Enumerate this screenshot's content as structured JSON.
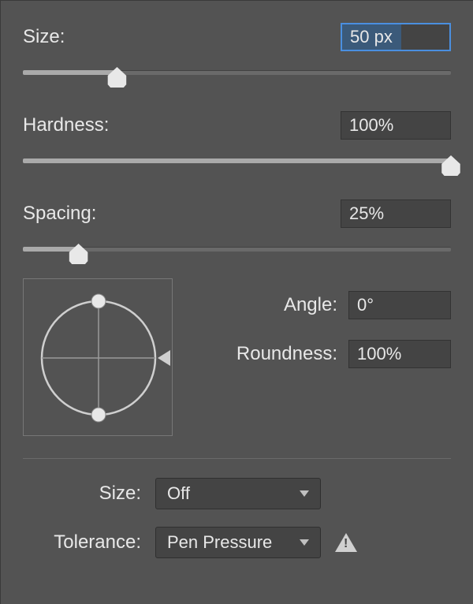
{
  "size": {
    "label": "Size:",
    "value": "50 px",
    "percent": 22
  },
  "hardness": {
    "label": "Hardness:",
    "value": "100%",
    "percent": 100
  },
  "spacing": {
    "label": "Spacing:",
    "value": "25%",
    "percent": 13
  },
  "angle": {
    "label": "Angle:",
    "value": "0°"
  },
  "roundness": {
    "label": "Roundness:",
    "value": "100%"
  },
  "dynSize": {
    "label": "Size:",
    "value": "Off"
  },
  "tolerance": {
    "label": "Tolerance:",
    "value": "Pen Pressure"
  }
}
